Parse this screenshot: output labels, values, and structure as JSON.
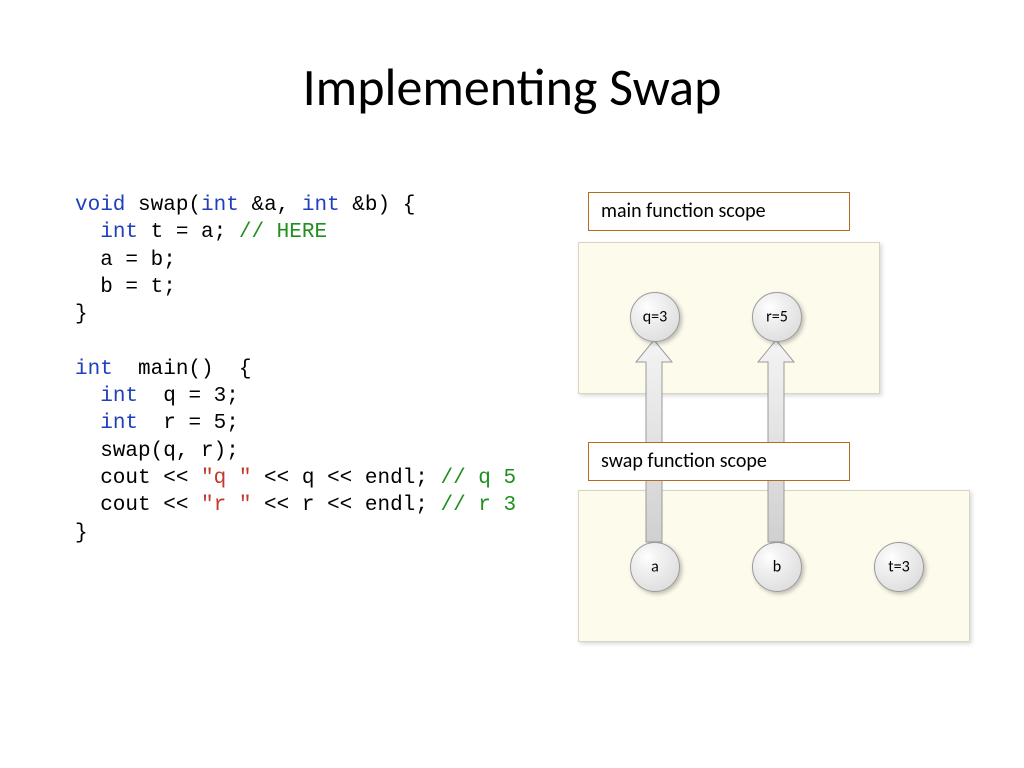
{
  "title": "Implementing Swap",
  "code": {
    "swap": {
      "sig_open": "void",
      "sig_name": " swap(",
      "sig_int1": "int",
      "sig_rest1": " &a, ",
      "sig_int2": "int",
      "sig_rest2": " &b) {",
      "l2_kw": "int",
      "l2_rest": " t = a; ",
      "l2_cmt": "// HERE",
      "l3": "  a = b;",
      "l4": "  b = t;",
      "l5": "}"
    },
    "main": {
      "sig_kw": "int",
      "sig_rest": "  main()  {",
      "l2_kw": "int",
      "l2_rest": "  q = 3;",
      "l3_kw": "int",
      "l3_rest": "  r = 5;",
      "l4": "  swap(q, r);",
      "l5_a": "  cout << ",
      "l5_s": "\"q \"",
      "l5_b": " << q << endl; ",
      "l5_c": "// q 5",
      "l6_a": "  cout << ",
      "l6_s": "\"r \"",
      "l6_b": " << r << endl; ",
      "l6_c": "// r 3",
      "l7": "}"
    }
  },
  "diagram": {
    "main_label": "main function scope",
    "swap_label": "swap function scope",
    "vars": {
      "q": "q=3",
      "r": "r=5",
      "a": "a",
      "b": "b",
      "t": "t=3"
    }
  }
}
